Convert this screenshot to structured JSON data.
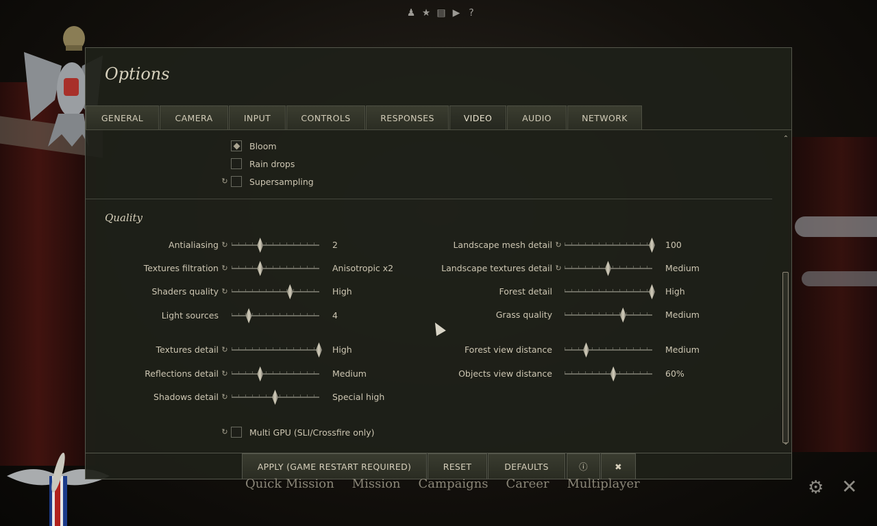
{
  "top_icons": [
    "pilot-icon",
    "medal-icon",
    "book-icon",
    "video-icon",
    "help-icon"
  ],
  "dialog": {
    "title": "Options",
    "tabs": [
      {
        "label": "GENERAL",
        "active": false
      },
      {
        "label": "CAMERA",
        "active": false
      },
      {
        "label": "INPUT",
        "active": false
      },
      {
        "label": "CONTROLS",
        "active": false
      },
      {
        "label": "RESPONSES",
        "active": false
      },
      {
        "label": "VIDEO",
        "active": true
      },
      {
        "label": "AUDIO",
        "active": false
      },
      {
        "label": "NETWORK",
        "active": false
      }
    ],
    "effects": {
      "bloom": {
        "label": "Bloom",
        "checked": true
      },
      "rain_drops": {
        "label": "Rain drops",
        "checked": false
      },
      "supersampling": {
        "label": "Supersampling",
        "checked": false,
        "restart": true
      }
    },
    "quality": {
      "title": "Quality",
      "left": [
        {
          "label": "Antialiasing",
          "value": "2",
          "level": 0.33,
          "restart": true
        },
        {
          "label": "Textures filtration",
          "value": "Anisotropic x2",
          "level": 0.33,
          "restart": true
        },
        {
          "label": "Shaders quality",
          "value": "High",
          "level": 0.67,
          "restart": true
        },
        {
          "label": "Light sources",
          "value": "4",
          "level": 0.2,
          "restart": false
        },
        {
          "label": "Textures detail",
          "value": "High",
          "level": 1.0,
          "restart": true
        },
        {
          "label": "Reflections detail",
          "value": "Medium",
          "level": 0.33,
          "restart": true
        },
        {
          "label": "Shadows detail",
          "value": "Special high",
          "level": 0.5,
          "restart": true
        }
      ],
      "right": [
        {
          "label": "Landscape mesh detail",
          "value": "100",
          "level": 1.0,
          "restart": true
        },
        {
          "label": "Landscape textures detail",
          "value": "Medium",
          "level": 0.5,
          "restart": true
        },
        {
          "label": "Forest detail",
          "value": "High",
          "level": 1.0,
          "restart": false
        },
        {
          "label": "Grass quality",
          "value": "Medium",
          "level": 0.67,
          "restart": false
        },
        {
          "label": "Forest view distance",
          "value": "Medium",
          "level": 0.25,
          "restart": false
        },
        {
          "label": "Objects view distance",
          "value": "60%",
          "level": 0.56,
          "restart": false
        }
      ],
      "multi_gpu": {
        "label": "Multi GPU (SLI/Crossfire only)",
        "checked": false,
        "restart": true
      }
    },
    "buttons": {
      "apply": "APPLY (GAME RESTART REQUIRED)",
      "reset": "RESET",
      "defaults": "DEFAULTS"
    }
  },
  "main_menu": [
    "Quick Mission",
    "Mission",
    "Campaigns",
    "Career",
    "Multiplayer"
  ],
  "colors": {
    "panel": "#1e2019",
    "text": "#cdc6b2",
    "accent": "#d4cfbd"
  }
}
